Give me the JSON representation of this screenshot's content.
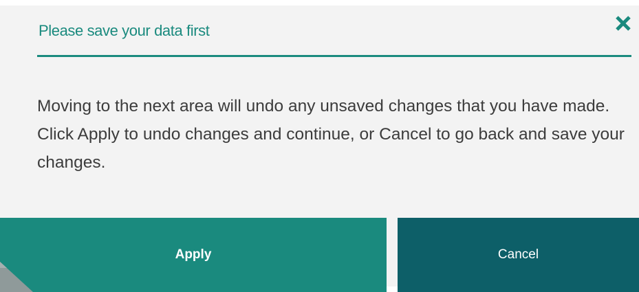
{
  "dialog": {
    "title": "Please save your data first",
    "close_icon": "close-icon",
    "message": "Moving to the next area will undo any unsaved changes that you have made. Click Apply to undo changes and continue, or Cancel to go back and save your changes."
  },
  "buttons": {
    "apply_label": "Apply",
    "cancel_label": "Cancel"
  },
  "colors": {
    "accent": "#1a8a7e",
    "cancel_bg": "#0d5f68",
    "dialog_bg": "#f3f3f3",
    "text": "#3c3c3c"
  }
}
